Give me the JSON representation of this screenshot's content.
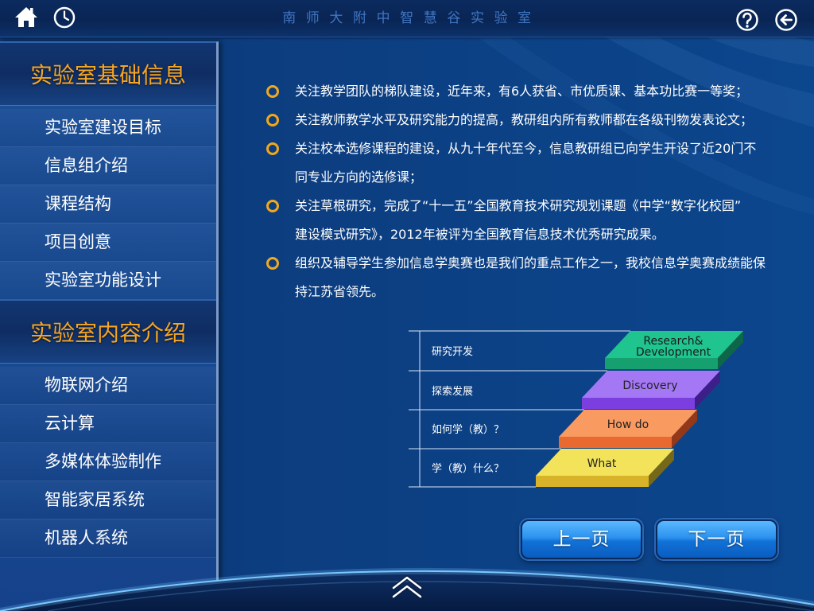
{
  "app": {
    "title": "南师大附中智慧谷实验室",
    "icons": {
      "home": "home-icon",
      "clock": "clock-icon",
      "help": "help-icon",
      "back": "back-arrow-icon"
    }
  },
  "sidebar": {
    "sections": [
      {
        "title": "实验室基础信息",
        "items": [
          {
            "label": "实验室建设目标"
          },
          {
            "label": "信息组介绍"
          },
          {
            "label": "课程结构"
          },
          {
            "label": "项目创意"
          },
          {
            "label": "实验室功能设计"
          }
        ]
      },
      {
        "title": "实验室内容介绍",
        "items": [
          {
            "label": "物联网介绍"
          },
          {
            "label": "云计算"
          },
          {
            "label": "多媒体体验制作"
          },
          {
            "label": "智能家居系统"
          },
          {
            "label": "机器人系统"
          }
        ]
      }
    ]
  },
  "main": {
    "bullet_icon": "ring-bullet-icon",
    "bullets": [
      {
        "lines": [
          "关注教学团队的梯队建设，近年来，有6人获省、市优质课、基本功比赛一等奖；"
        ]
      },
      {
        "lines": [
          "关注教师教学水平及研究能力的提高，教研组内所有教师都在各级刊物发表论文；"
        ]
      },
      {
        "lines": [
          "关注校本选修课程的建设，从九十年代至今，信息教研组已向学生开设了近20门不",
          "同专业方向的选修课；"
        ]
      },
      {
        "lines": [
          "关注草根研究，完成了“十一五”全国教育技术研究规划课题《中学“数字化校园”",
          "建设模式研究》，2012年被评为全国教育信息技术优秀研究成果。"
        ]
      },
      {
        "lines": [
          "组织及辅导学生参加信息学奥赛也是我们的重点工作之一，我校信息学奥赛成绩能保",
          "持江苏省领先。"
        ]
      }
    ]
  },
  "diagram": {
    "steps": [
      {
        "label_lines": [
          "Research&",
          "Development"
        ],
        "axis_label": "研究开发",
        "colors": {
          "top": "#1fc48f",
          "front": "#16a070",
          "side": "#0e6648"
        }
      },
      {
        "label_lines": [
          "Discovery"
        ],
        "axis_label": "探索发展",
        "colors": {
          "top": "#a478f4",
          "front": "#7b3fe0",
          "side": "#3d1f8a"
        }
      },
      {
        "label_lines": [
          "How do"
        ],
        "axis_label": "如何学（教）？",
        "colors": {
          "top": "#f99a60",
          "front": "#e86a30",
          "side": "#93391a"
        }
      },
      {
        "label_lines": [
          "What"
        ],
        "axis_label": "学（教）什么？",
        "colors": {
          "top": "#f2e35a",
          "front": "#d8b228",
          "side": "#756818"
        }
      }
    ],
    "line_color": "#d8e6f7"
  },
  "pager": {
    "prev_label": "上一页",
    "next_label": "下一页"
  },
  "footer": {
    "toggle_icon": "double-chevron-up-icon"
  },
  "theme": {
    "accent": "#f6a623",
    "title_color": "#3f76c2",
    "bullet_color": "#f0a81e",
    "background": "#0c3f82"
  }
}
